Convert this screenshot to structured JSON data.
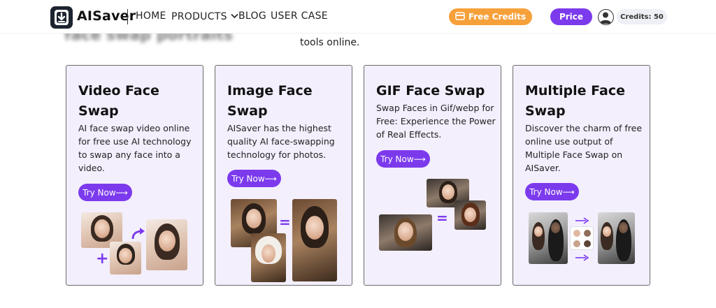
{
  "header": {
    "brand": "AISaver",
    "nav": {
      "home": "HOME",
      "products": "PRODUCTS",
      "blog": "BLOG",
      "user_case": "USER CASE"
    },
    "free_credits_label": "Free Credits",
    "price_label": "Price",
    "credits_label": "Credits: 50"
  },
  "intro": {
    "faded_heading": "face swap portraits",
    "subtitle": "tools online."
  },
  "cards": [
    {
      "title": "Video Face Swap",
      "description": "AI face swap video online for free use AI technology to swap any face into a video.",
      "button": "Try Now⟶"
    },
    {
      "title": "Image Face Swap",
      "description": "AISaver has the highest quality AI face-swapping technology for photos.",
      "button": "Try Now⟶"
    },
    {
      "title": "GIF Face Swap",
      "description": "Swap Faces in Gif/webp for Free: Experience the Power of Real Effects.",
      "button": "Try Now⟶"
    },
    {
      "title": "Multiple Face Swap",
      "description": "Discover the charm of free online use output of Multiple Face Swap on AISaver.",
      "button": "Try Now⟶"
    }
  ],
  "colors": {
    "accent": "#7c3aed",
    "orange": "#f6a03a",
    "card_bg": "#f3effd"
  },
  "icons": [
    "download-logo-icon",
    "chevron-down-icon",
    "coin-icon",
    "user-avatar-icon",
    "plus-icon",
    "equals-icon",
    "arrow-icon"
  ]
}
